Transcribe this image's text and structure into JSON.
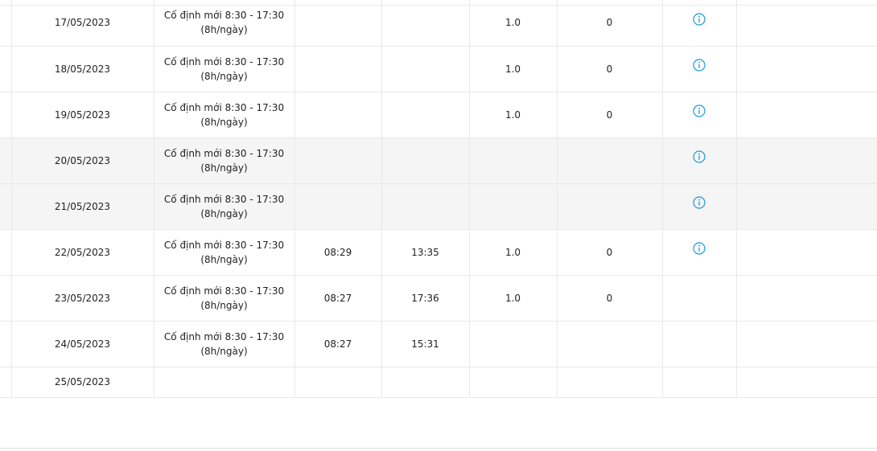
{
  "colors": {
    "border": "#e8e8e8",
    "weekend_row": "#f5f5f5",
    "info_icon": "#1a9ad6",
    "text": "#222222"
  },
  "rows": [
    {
      "date": "17/05/2023",
      "shift_line1": "Cố định mới 8:30 - 17:30",
      "shift_line2": "(8h/ngày)",
      "check_in": "",
      "check_out": "",
      "work_day": "1.0",
      "late_minutes": "0",
      "info_icon": "info-circle-icon",
      "weekend": false
    },
    {
      "date": "18/05/2023",
      "shift_line1": "Cố định mới 8:30 - 17:30",
      "shift_line2": "(8h/ngày)",
      "check_in": "",
      "check_out": "",
      "work_day": "1.0",
      "late_minutes": "0",
      "info_icon": "info-circle-icon",
      "weekend": false
    },
    {
      "date": "19/05/2023",
      "shift_line1": "Cố định mới 8:30 - 17:30",
      "shift_line2": "(8h/ngày)",
      "check_in": "",
      "check_out": "",
      "work_day": "1.0",
      "late_minutes": "0",
      "info_icon": "info-circle-icon",
      "weekend": false
    },
    {
      "date": "20/05/2023",
      "shift_line1": "Cố định mới 8:30 - 17:30",
      "shift_line2": "(8h/ngày)",
      "check_in": "",
      "check_out": "",
      "work_day": "",
      "late_minutes": "",
      "info_icon": "info-circle-icon",
      "weekend": true
    },
    {
      "date": "21/05/2023",
      "shift_line1": "Cố định mới 8:30 - 17:30",
      "shift_line2": "(8h/ngày)",
      "check_in": "",
      "check_out": "",
      "work_day": "",
      "late_minutes": "",
      "info_icon": "info-circle-icon",
      "weekend": true
    },
    {
      "date": "22/05/2023",
      "shift_line1": "Cố định mới 8:30 - 17:30",
      "shift_line2": "(8h/ngày)",
      "check_in": "08:29",
      "check_out": "13:35",
      "work_day": "1.0",
      "late_minutes": "0",
      "info_icon": "info-circle-icon",
      "weekend": false
    },
    {
      "date": "23/05/2023",
      "shift_line1": "Cố định mới 8:30 - 17:30",
      "shift_line2": "(8h/ngày)",
      "check_in": "08:27",
      "check_out": "17:36",
      "work_day": "1.0",
      "late_minutes": "0",
      "info_icon": "",
      "weekend": false
    },
    {
      "date": "24/05/2023",
      "shift_line1": "Cố định mới 8:30 - 17:30",
      "shift_line2": "(8h/ngày)",
      "check_in": "08:27",
      "check_out": "15:31",
      "work_day": "",
      "late_minutes": "",
      "info_icon": "",
      "weekend": false
    },
    {
      "date": "25/05/2023",
      "shift_line1": "",
      "shift_line2": "",
      "check_in": "",
      "check_out": "",
      "work_day": "",
      "late_minutes": "",
      "info_icon": "",
      "weekend": false
    }
  ]
}
